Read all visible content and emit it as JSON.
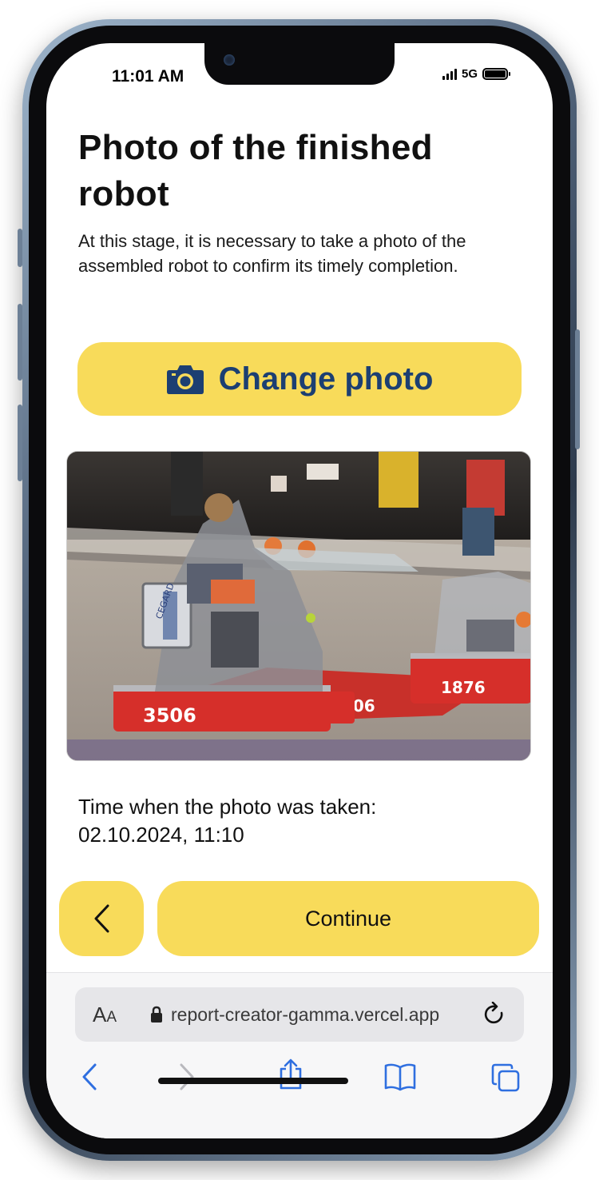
{
  "status_bar": {
    "time": "11:01 AM",
    "network": "5G"
  },
  "page": {
    "title": "Photo of the finished robot",
    "description": "At this stage, it is necessary to take a photo of the assembled robot to confirm its timely completion.",
    "change_photo_label": "Change photo",
    "photo": {
      "robot_numbers": [
        "3506",
        "3506",
        "1876"
      ],
      "robot_label": "CEGARD"
    },
    "timestamp_label": "Time when the photo was taken:",
    "timestamp_value": "02.10.2024, 11:10",
    "continue_label": "Continue"
  },
  "browser": {
    "text_size_label": "A",
    "text_size_label_small": "A",
    "url": "report-creator-gamma.vercel.app"
  },
  "colors": {
    "accent_button": "#f8db5a",
    "button_text": "#1c3f72",
    "safari_blue": "#2f6fe0"
  },
  "icons": [
    "camera-icon",
    "chevron-left-icon",
    "lock-icon",
    "reload-icon",
    "back-arrow-icon",
    "forward-arrow-icon",
    "share-icon",
    "bookmarks-icon",
    "tabs-icon"
  ]
}
